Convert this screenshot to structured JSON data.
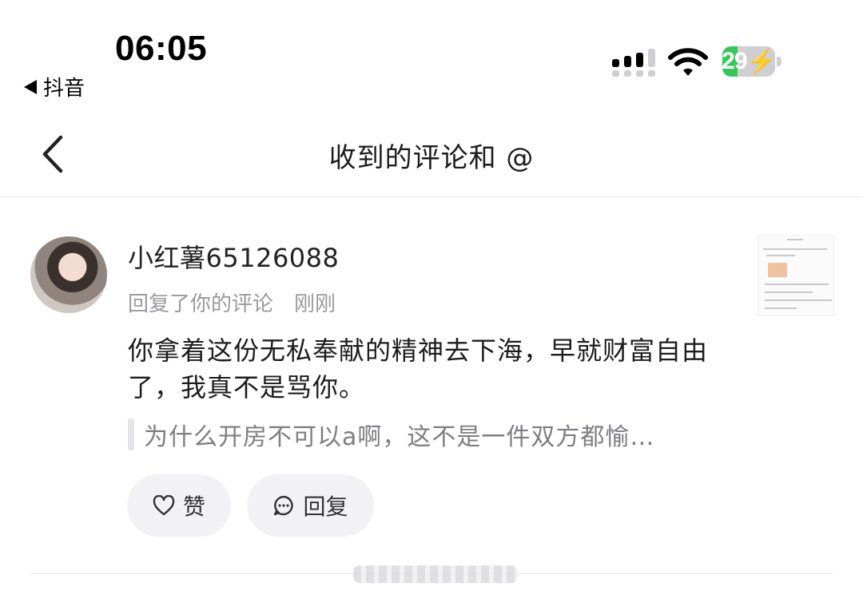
{
  "status_bar": {
    "time": "06:05",
    "back_app": "抖音",
    "battery_percent": 29,
    "battery_label": "29"
  },
  "nav": {
    "title": "收到的评论和 @"
  },
  "comment": {
    "username": "小红薯65126088",
    "action": "回复了你的评论",
    "time": "刚刚",
    "text": "你拿着这份无私奉献的精神去下海，早就财富自由了，我真不是骂你。",
    "quoted": "为什么开房不可以a啊，这不是一件双方都愉…",
    "like_label": "赞",
    "reply_label": "回复"
  },
  "colors": {
    "battery_green": "#34c759",
    "button_bg": "#f2f2f4",
    "meta_gray": "#9a9a9e"
  },
  "icons": [
    "back-triangle-icon",
    "cellular-signal-icon",
    "wifi-icon",
    "battery-icon",
    "chevron-left-icon",
    "heart-icon",
    "comment-bubble-icon"
  ]
}
